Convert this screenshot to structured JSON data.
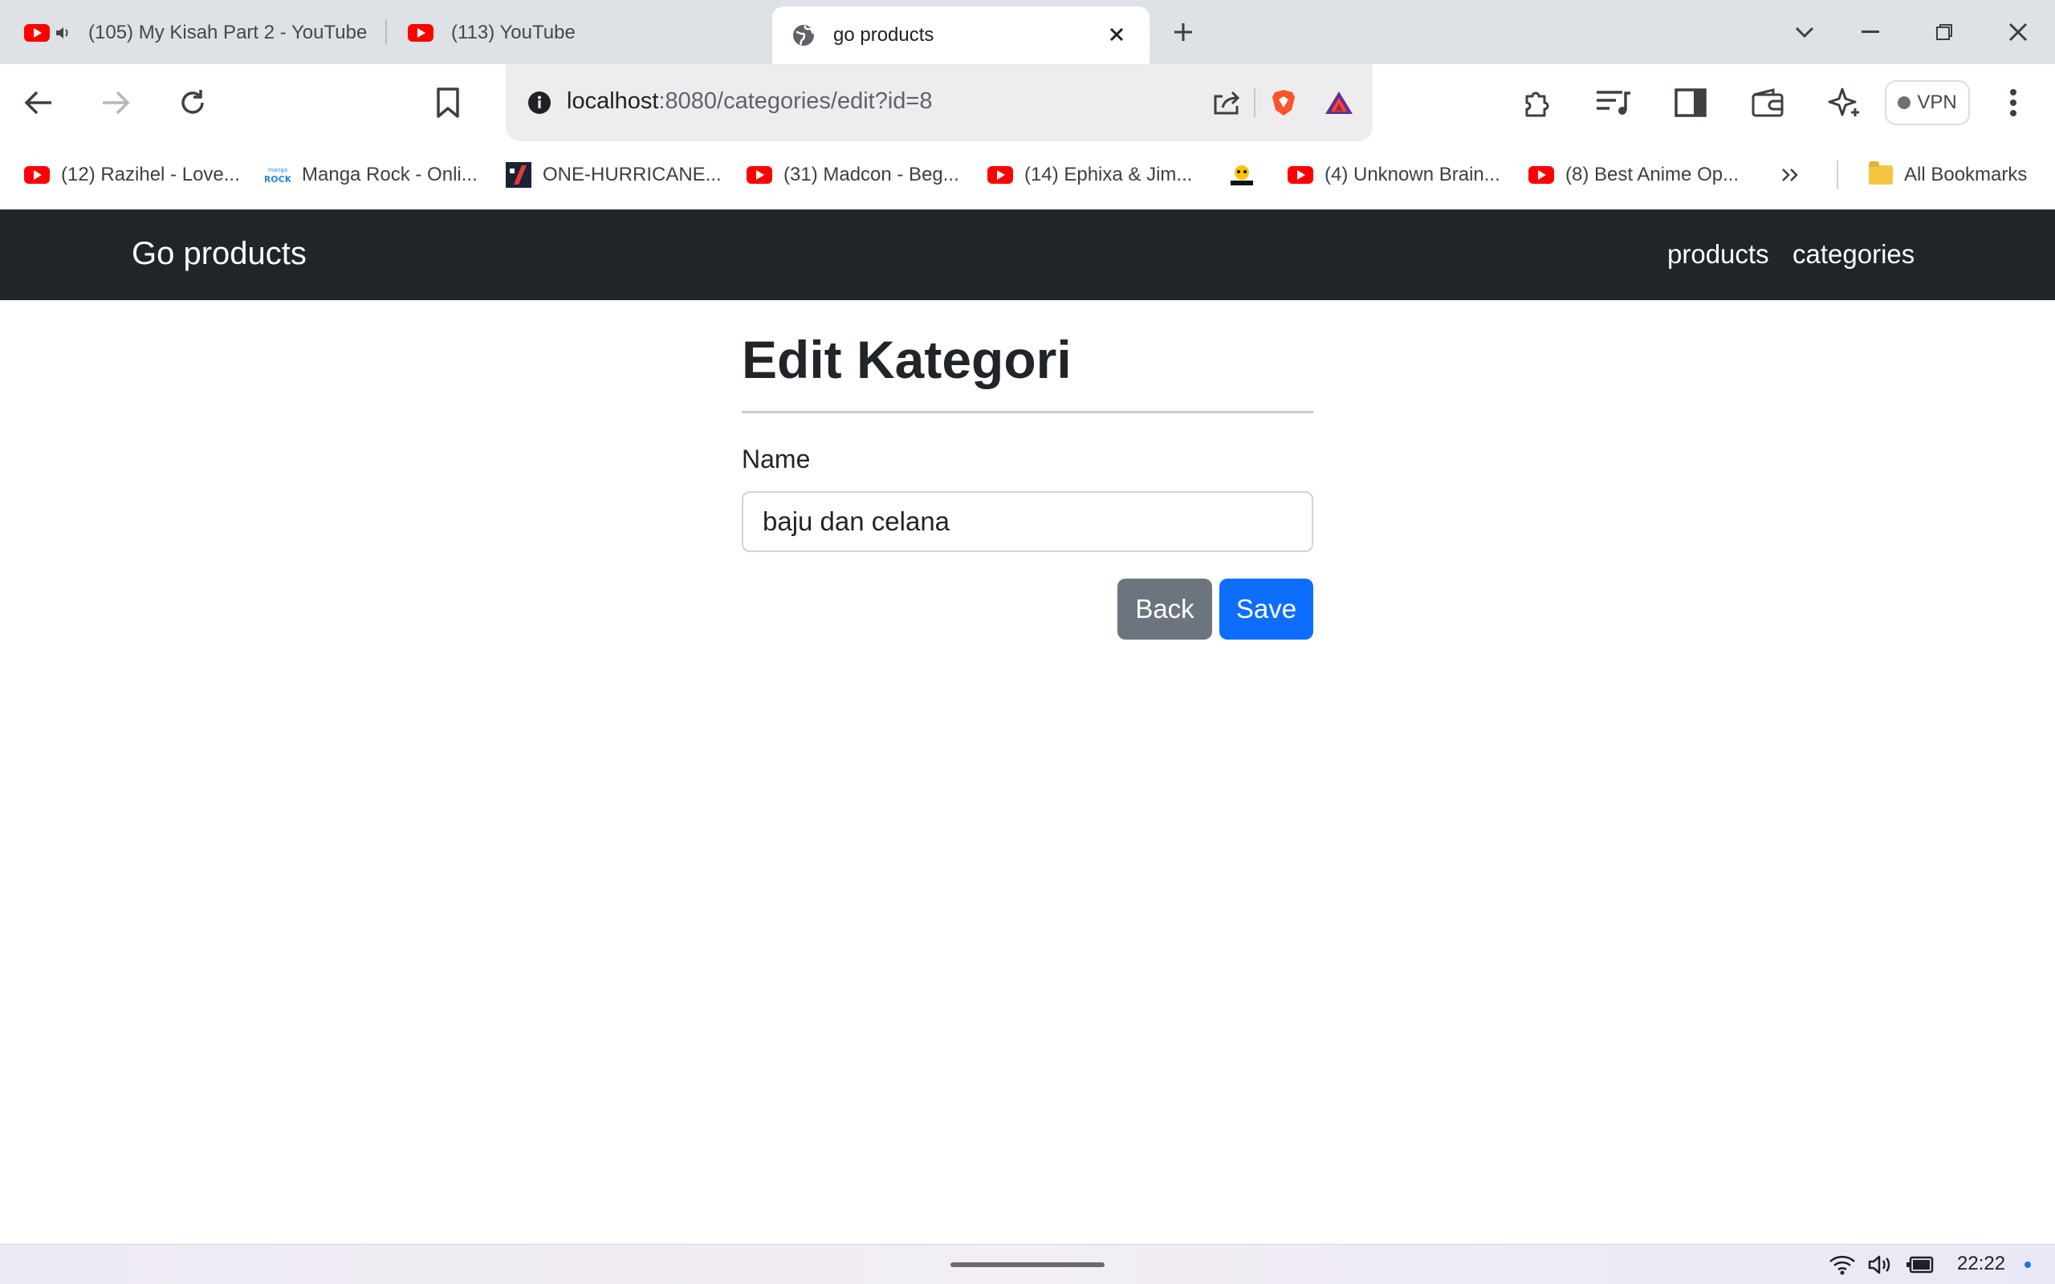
{
  "browser": {
    "tabs": [
      {
        "title": "(105) My Kisah Part 2 - YouTube",
        "favicon": "youtube-icon",
        "audio": "speaker-icon"
      },
      {
        "title": "(113) YouTube",
        "favicon": "youtube-icon"
      },
      {
        "title": "go products",
        "favicon": "globe-icon",
        "active": true
      }
    ],
    "address": {
      "host": "localhost",
      "rest": ":8080/categories/edit?id=8"
    },
    "vpn_label": "VPN",
    "bookmarks": [
      {
        "label": "(12) Razihel - Love...",
        "icon": "youtube-icon"
      },
      {
        "label": "Manga Rock - Onli...",
        "icon": "manga-rock-icon"
      },
      {
        "label": "ONE-HURRICANE...",
        "icon": "one-hurricane-icon"
      },
      {
        "label": "(31) Madcon - Beg...",
        "icon": "youtube-icon"
      },
      {
        "label": "(14) Ephixa & Jim...",
        "icon": "youtube-icon"
      },
      {
        "label": "",
        "icon": "anime-logo-icon"
      },
      {
        "label": "(4) Unknown Brain...",
        "icon": "youtube-icon"
      },
      {
        "label": "(8) Best Anime Op...",
        "icon": "youtube-icon"
      }
    ],
    "all_bookmarks_label": "All Bookmarks"
  },
  "page": {
    "brand": "Go products",
    "nav": [
      "products",
      "categories"
    ],
    "title": "Edit Kategori",
    "form": {
      "name_label": "Name",
      "name_value": "baju dan celana"
    },
    "buttons": {
      "back": "Back",
      "save": "Save"
    }
  },
  "system": {
    "time": "22:22"
  },
  "colors": {
    "navbar_bg": "#212529",
    "back_button": "#6c757d",
    "save_button": "#0d6efd",
    "youtube_red": "#ff0000",
    "brave_orange": "#fb542b"
  }
}
